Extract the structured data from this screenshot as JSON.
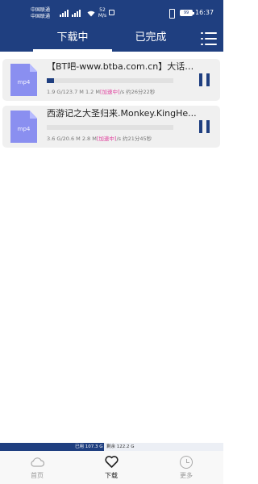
{
  "status_bar": {
    "carrier_1": "中国联通",
    "carrier_2": "中国联通",
    "speed_value": "52",
    "speed_unit": "M/s",
    "battery": "99",
    "time": "16:37"
  },
  "header": {
    "tabs": [
      {
        "label": "下载中",
        "active": true
      },
      {
        "label": "已完成",
        "active": false
      }
    ],
    "menu_icon": "hamburger-menu-icon"
  },
  "downloads": [
    {
      "file_ext": "mp4",
      "title": "【BT吧-www.btba.com.cn】大话西...",
      "progress": 0.06,
      "size_info": "1.9 G/123.7 M 1.2 M",
      "accel_label": "[加速中]",
      "speed_suffix": "/s",
      "eta": "约26分22秒",
      "state_icon": "pause-icon"
    },
    {
      "file_ext": "mp4",
      "title": "西游记之大圣归来.Monkey.KingHe...",
      "progress": 0.0,
      "size_info": "3.6 G/20.6 M 2.8 M",
      "accel_label": "[加速中]",
      "speed_suffix": "/s",
      "eta": "约21分45秒",
      "state_icon": "pause-icon"
    }
  ],
  "storage": {
    "used_label": "已用 107.3 G",
    "free_label": "剩余 122.2 G",
    "used_fraction": 0.467
  },
  "bottom_nav": [
    {
      "label": "首页",
      "icon": "cloud-icon"
    },
    {
      "label": "下载",
      "icon": "heart-icon",
      "active": true
    },
    {
      "label": "更多",
      "icon": "clock-icon"
    }
  ],
  "colors": {
    "brand": "#1f3f80",
    "accel": "#e0419d",
    "file_icon": "#8a8ff0"
  }
}
